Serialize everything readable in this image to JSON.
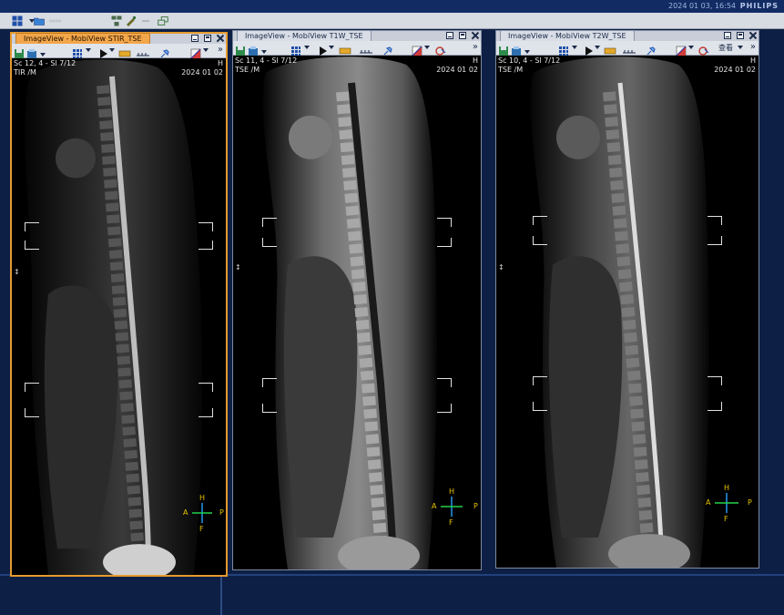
{
  "header": {
    "datetime": "2024 01 03, 16:54",
    "brand": "PHILIPS"
  },
  "colors": {
    "accent_active": "#e59a2f",
    "orientation": "#e8c400",
    "orient_axis_h": "#2aa4ff",
    "orient_axis_a": "#22d24a"
  },
  "viewports": [
    {
      "tab": "ImageView - MobiView STIR_TSE",
      "series_info": "Sc 12, 4 - Sl 7/12",
      "sequence": "TIR  /M",
      "date": "2024 01 02",
      "top_marker": "H",
      "orient": {
        "top": "H",
        "bottom": "F",
        "left": "A",
        "right": "P"
      },
      "extra_label": ""
    },
    {
      "tab": "ImageView - MobiView T1W_TSE",
      "series_info": "Sc 11, 4 - Sl 7/12",
      "sequence": "TSE  /M",
      "date": "2024 01 02",
      "top_marker": "H",
      "orient": {
        "top": "H",
        "bottom": "F",
        "left": "A",
        "right": "P"
      },
      "extra_label": ""
    },
    {
      "tab": "ImageView - MobiView T2W_TSE",
      "series_info": "Sc 10, 4 - Sl 7/12",
      "sequence": "TSE  /M",
      "date": "2024 01 02",
      "top_marker": "H",
      "orient": {
        "top": "H",
        "bottom": "F",
        "left": "A",
        "right": "P"
      },
      "extra_label": "查看"
    }
  ],
  "icons": {
    "main_toolbar": [
      "layout-grid-icon",
      "folder-icon",
      "tools-icon",
      "network-icon",
      "export-icon"
    ],
    "viewport_toolbar": [
      "save-icon",
      "print-icon",
      "grid-icon",
      "play-icon",
      "measure-icon",
      "ruler-icon",
      "pin-icon",
      "colormap-icon",
      "overlay-icon"
    ]
  }
}
